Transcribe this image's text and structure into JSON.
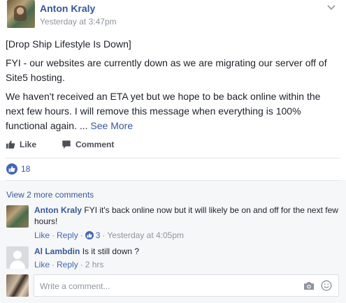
{
  "post": {
    "author": "Anton Kraly",
    "timestamp": "Yesterday at 3:47pm",
    "paragraphs": [
      "[Drop Ship Lifestyle Is Down]",
      "FYI - our websites are currently down as we are migrating our server off of Site5 hosting.",
      "We haven't received an ETA yet but we hope to be back online within the next few hours. I will remove this message when everything is 100% functional again. ..."
    ],
    "see_more": "See More"
  },
  "actions": {
    "like": "Like",
    "comment": "Comment"
  },
  "reactions": {
    "count": "18"
  },
  "comments_section": {
    "view_more": "View 2 more comments",
    "comments": [
      {
        "author": "Anton Kraly",
        "text": "FYI it's back online now but it will likely be on and off for the next few hours!",
        "like": "Like",
        "reply": "Reply",
        "reaction_count": "3",
        "time": "Yesterday at 4:05pm"
      },
      {
        "author": "Al Lambdin",
        "text": "Is it still down ?",
        "like": "Like",
        "reply": "Reply",
        "time": "2 hrs"
      }
    ],
    "write_placeholder": "Write a comment..."
  },
  "colors": {
    "link": "#365899",
    "meta": "#90949c",
    "like_blue": "#4267b2",
    "comments_bg": "#f6f7f9"
  }
}
